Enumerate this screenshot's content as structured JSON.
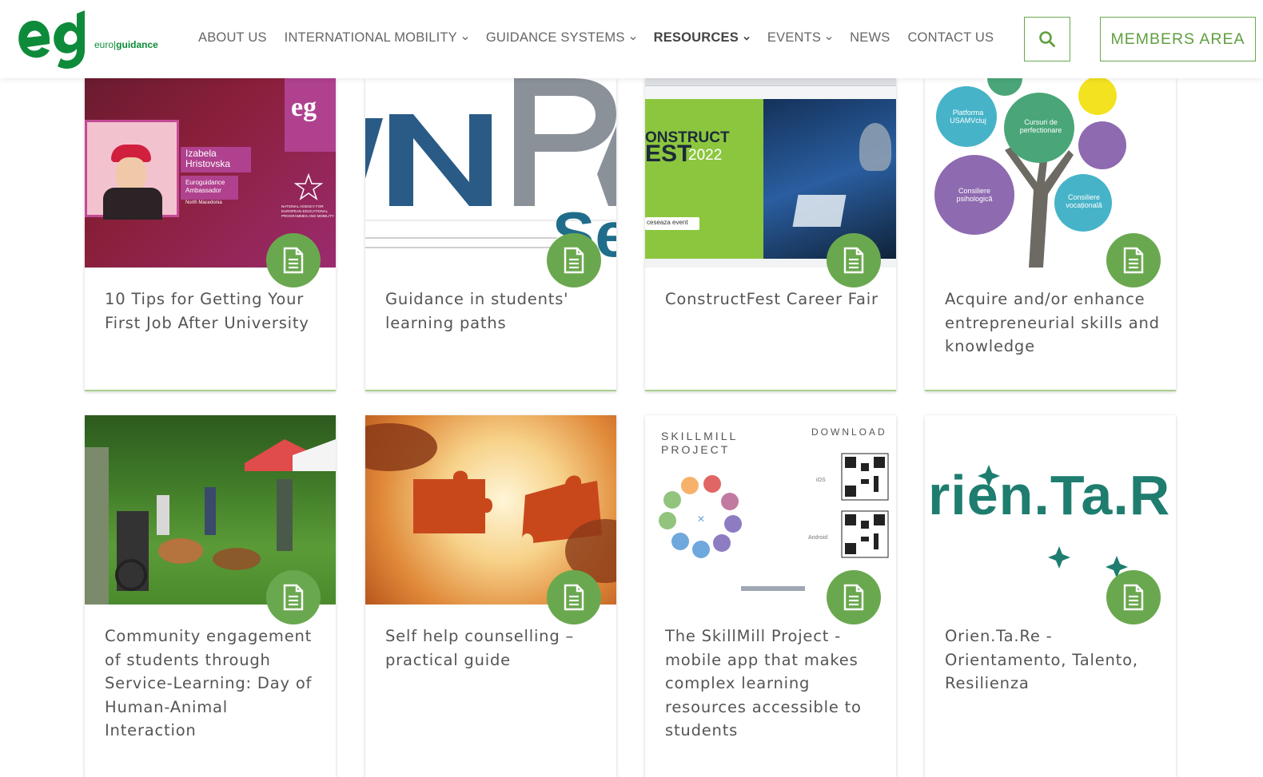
{
  "header": {
    "logo_text_left": "euro",
    "logo_text_sep": "|",
    "logo_text_right": "guidance",
    "nav": [
      {
        "label": "ABOUT US",
        "dropdown": false,
        "active": false
      },
      {
        "label": "INTERNATIONAL MOBILITY",
        "dropdown": true,
        "active": false
      },
      {
        "label": "GUIDANCE SYSTEMS",
        "dropdown": true,
        "active": false
      },
      {
        "label": "RESOURCES",
        "dropdown": true,
        "active": true
      },
      {
        "label": "EVENTS",
        "dropdown": true,
        "active": false
      },
      {
        "label": "NEWS",
        "dropdown": false,
        "active": false
      },
      {
        "label": "CONTACT US",
        "dropdown": false,
        "active": false
      }
    ],
    "search_icon": "search-icon",
    "members_label": "MEMBERS AREA"
  },
  "colors": {
    "brand_green": "#0e8b3a",
    "accent_green": "#6aa84f",
    "text": "#555555"
  },
  "cards": [
    {
      "title": "10 Tips for Getting Your First Job After University",
      "icon": "document-icon",
      "thumb": {
        "name": "Izabela Hristovska",
        "role": "Euroguidance Ambassador",
        "country": "North Macedonia",
        "agency": "NATIONAL AGENCY FOR EUROPEAN EDUCATIONAL PROGRAMMES AND MOBILITY"
      }
    },
    {
      "title": "Guidance in students' learning paths",
      "icon": "document-icon",
      "thumb": {
        "logo_text": "ANPA",
        "sub_text": "Se"
      }
    },
    {
      "title": "ConstructFest Career Fair",
      "icon": "document-icon",
      "thumb": {
        "line1": "ONSTRUCT",
        "line2": "EST",
        "year": "2022",
        "button": "ceseaza event"
      }
    },
    {
      "title": "Acquire and/or enhance entrepreneurial skills and knowledge",
      "icon": "document-icon",
      "thumb": {
        "bubbles": [
          "Platforma USAMVcluj",
          "Cursuri de perfectionare",
          "Consiliere psihologică",
          "Consiliere vocațională"
        ]
      }
    },
    {
      "title": "Community engagement of students through Service-Learning: Day of Human-Animal Interaction",
      "icon": "document-icon",
      "thumb": {}
    },
    {
      "title": "Self help counselling – practical guide",
      "icon": "document-icon",
      "thumb": {}
    },
    {
      "title": "The SkillMill Project - mobile app that makes complex learning resources accessible to students",
      "icon": "document-icon",
      "thumb": {
        "heading": "SKILLMILL PROJECT",
        "download": "DOWNLOAD",
        "ios": "iOS",
        "android": "Android"
      }
    },
    {
      "title": "Orien.Ta.Re - Orientamento, Talento, Resilienza",
      "icon": "document-icon",
      "thumb": {
        "logo_text": "rien.Ta.R"
      }
    }
  ]
}
